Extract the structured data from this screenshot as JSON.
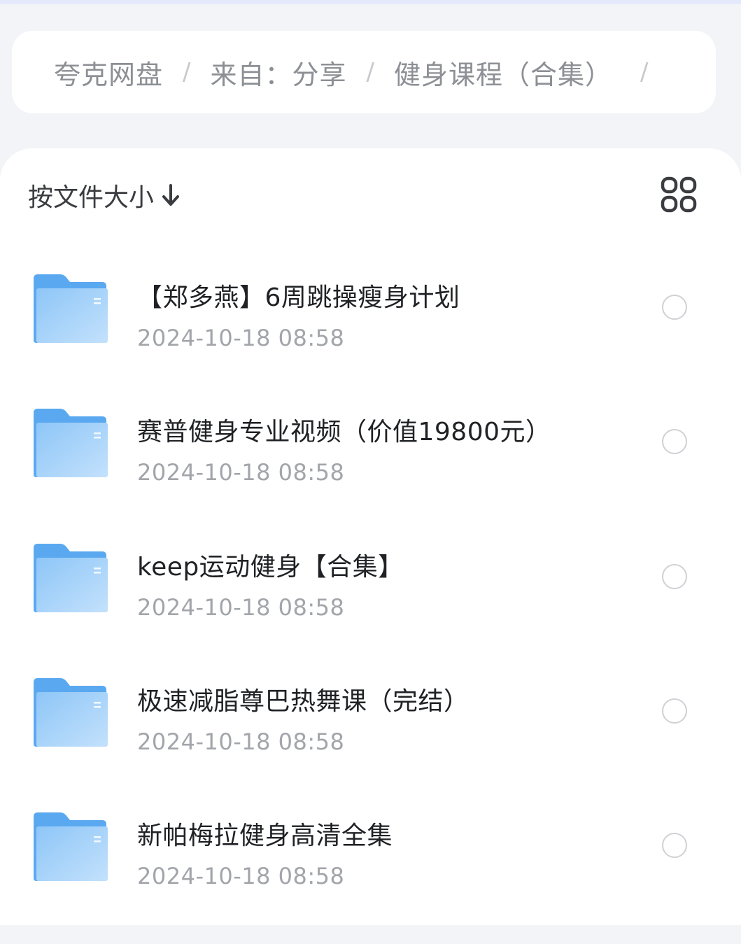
{
  "breadcrumb": {
    "items": [
      "夸克网盘",
      "来自：分享",
      "健身课程（合集）"
    ],
    "separator": "/"
  },
  "toolbar": {
    "sort_label": "按文件大小",
    "sort_icon": "arrow-down-icon",
    "view_toggle_icon": "grid-view-icon"
  },
  "files": [
    {
      "name": "【郑多燕】6周跳操瘦身计划",
      "date": "2024-10-18 08:58",
      "type": "folder"
    },
    {
      "name": "赛普健身专业视频（价值19800元）",
      "date": "2024-10-18 08:58",
      "type": "folder"
    },
    {
      "name": "keep运动健身【合集】",
      "date": "2024-10-18 08:58",
      "type": "folder"
    },
    {
      "name": "极速减脂尊巴热舞课（完结）",
      "date": "2024-10-18 08:58",
      "type": "folder"
    },
    {
      "name": "新帕梅拉健身高清全集",
      "date": "2024-10-18 08:58",
      "type": "folder"
    }
  ],
  "colors": {
    "background": "#f3f4f7",
    "folder_back": "#5aa9f0",
    "folder_front_light": "#b9dcfb",
    "radio_border": "#cfd1d5",
    "date_text": "#a2a5aa"
  }
}
